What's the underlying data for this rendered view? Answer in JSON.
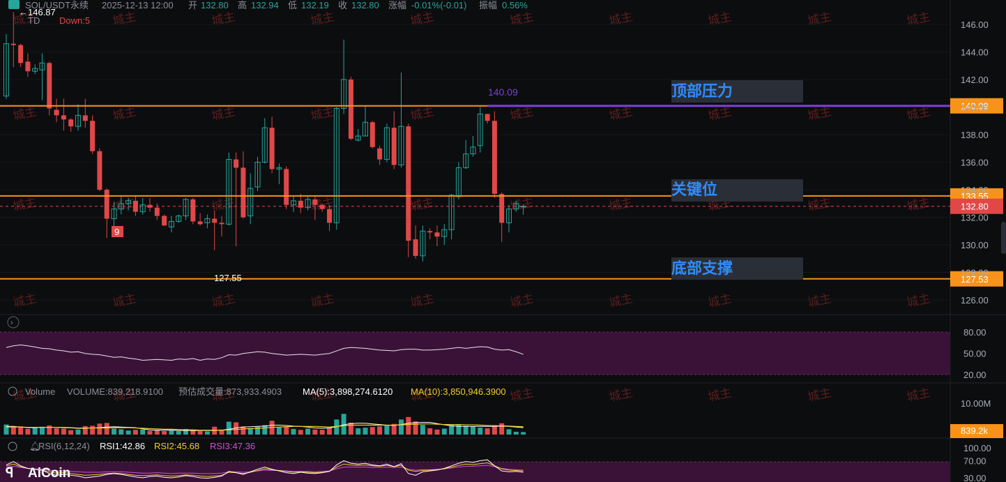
{
  "header": {
    "symbol": "SOL/USDT永续",
    "datetime": "2025-12-13 12:00",
    "open_label": "开",
    "open": "132.80",
    "high_label": "高",
    "high": "132.94",
    "low_label": "低",
    "low": "132.19",
    "close_label": "收",
    "close": "132.80",
    "change_label": "涨幅",
    "change": "-0.01%(-0.01)",
    "amp_label": "振幅",
    "amp": "0.56%",
    "td_label": "TD",
    "td_down": "Down:5",
    "max_label": "146.87"
  },
  "watermark": "城主",
  "price_axis": {
    "ticks": [
      "146.00",
      "144.00",
      "142.00",
      "140.00",
      "138.00",
      "136.00",
      "134.00",
      "132.00",
      "130.00",
      "128.00",
      "126.00"
    ]
  },
  "levels": [
    {
      "id": "top",
      "label": "顶部压力",
      "price": 140.09,
      "tag": "140.09",
      "color": "#f7931a"
    },
    {
      "id": "key",
      "label": "关键位",
      "price": 133.55,
      "tag": "133.55",
      "color": "#f7931a"
    },
    {
      "id": "bottom",
      "label": "底部支撑",
      "price": 127.53,
      "tag": "127.53",
      "color": "#f7931a"
    }
  ],
  "current_price": {
    "value": 132.8,
    "tag": "132.80"
  },
  "purple_line": {
    "price": 140.09,
    "label": "140.09",
    "color": "#7b3fd6"
  },
  "low_marker": "127.55",
  "td_count_label": "9",
  "panel_indicator": {
    "ticks": [
      "80.00",
      "50.00",
      "20.00"
    ],
    "upper": 80,
    "lower": 20
  },
  "volume": {
    "label": "Volume",
    "volume_text": "VOLUME:839,218.9100",
    "est_text": "预估成交量:873,933.4903",
    "ma5_text": "MA(5):3,898,274.6120",
    "ma10_text": "MA(10):3,850,946.3900",
    "axis_label": "10.00M",
    "tag": "839.2k"
  },
  "rsi": {
    "label": "RSI(6,12,24)",
    "rsi1": "RSI1:42.86",
    "rsi2": "RSI2:45.68",
    "rsi3": "RSI3:47.36",
    "ticks": [
      "100.00",
      "70.00",
      "30.00"
    ]
  },
  "logo": "AiCoin",
  "colors": {
    "up": "#26a69a",
    "down": "#e04848",
    "level": "#f7931a",
    "purple": "#7b3fd6",
    "label": "#2f8cff"
  },
  "chart_data": {
    "type": "candlestick",
    "ylim": [
      125.5,
      147.5
    ],
    "candles": [
      [
        140.8,
        144.6,
        140.6,
        145.3
      ],
      [
        144.6,
        144.5,
        142.9,
        146.9
      ],
      [
        144.5,
        143.2,
        142.9,
        144.6
      ],
      [
        143.3,
        142.6,
        142.2,
        143.9
      ],
      [
        142.6,
        142.8,
        142.4,
        143.1
      ],
      [
        142.7,
        143.2,
        140.5,
        143.9
      ],
      [
        143.2,
        139.9,
        139.4,
        143.3
      ],
      [
        139.8,
        139.4,
        138.9,
        140.6
      ],
      [
        139.4,
        139.1,
        138.3,
        140.6
      ],
      [
        139.1,
        138.6,
        138.2,
        139.2
      ],
      [
        138.6,
        139.4,
        138.3,
        140.2
      ],
      [
        139.4,
        139.0,
        138.5,
        140.6
      ],
      [
        139.0,
        136.8,
        136.6,
        139.4
      ],
      [
        136.8,
        134.0,
        133.9,
        137.0
      ],
      [
        134.0,
        131.9,
        130.5,
        134.1
      ],
      [
        131.9,
        132.6,
        131.2,
        133.1
      ],
      [
        132.6,
        133.0,
        132.2,
        133.6
      ],
      [
        133.0,
        133.2,
        132.5,
        133.4
      ],
      [
        133.2,
        132.4,
        132.1,
        133.6
      ],
      [
        132.4,
        132.9,
        132.2,
        133.4
      ],
      [
        132.9,
        132.7,
        132.4,
        133.4
      ],
      [
        132.7,
        132.1,
        131.8,
        133.0
      ],
      [
        132.1,
        131.4,
        131.4,
        132.2
      ],
      [
        131.3,
        131.7,
        130.9,
        132.1
      ],
      [
        131.7,
        132.1,
        131.6,
        132.2
      ],
      [
        132.1,
        133.3,
        131.8,
        133.4
      ],
      [
        133.3,
        131.7,
        131.5,
        133.4
      ],
      [
        131.7,
        131.5,
        131.4,
        132.3
      ],
      [
        131.6,
        131.9,
        131.2,
        132.2
      ],
      [
        131.9,
        131.6,
        129.6,
        132.5
      ],
      [
        131.6,
        131.5,
        130.6,
        132.1
      ],
      [
        131.5,
        136.2,
        131.4,
        136.7
      ],
      [
        136.2,
        135.6,
        129.9,
        136.7
      ],
      [
        135.6,
        132.0,
        131.9,
        136.8
      ],
      [
        132.1,
        134.1,
        131.5,
        135.2
      ],
      [
        134.2,
        136.0,
        133.9,
        136.4
      ],
      [
        136.0,
        138.5,
        135.9,
        139.2
      ],
      [
        138.5,
        135.5,
        135.2,
        139.3
      ],
      [
        135.5,
        135.6,
        134.4,
        135.9
      ],
      [
        135.5,
        132.9,
        132.6,
        135.7
      ],
      [
        132.9,
        133.2,
        132.4,
        133.6
      ],
      [
        133.2,
        132.7,
        132.3,
        133.7
      ],
      [
        132.7,
        133.3,
        132.5,
        133.6
      ],
      [
        133.3,
        132.9,
        131.8,
        133.6
      ],
      [
        132.9,
        132.6,
        132.4,
        133.0
      ],
      [
        132.6,
        131.6,
        131.0,
        132.9
      ],
      [
        131.6,
        139.9,
        131.1,
        140.0
      ],
      [
        139.9,
        142.0,
        139.5,
        144.9
      ],
      [
        142.0,
        137.7,
        137.6,
        142.2
      ],
      [
        137.6,
        137.9,
        137.5,
        138.4
      ],
      [
        137.9,
        138.9,
        137.9,
        140.1
      ],
      [
        138.9,
        137.1,
        137.0,
        139.0
      ],
      [
        137.0,
        136.2,
        135.8,
        137.2
      ],
      [
        136.2,
        138.5,
        136.0,
        138.8
      ],
      [
        138.5,
        135.8,
        135.5,
        139.7
      ],
      [
        135.8,
        138.6,
        135.6,
        142.5
      ],
      [
        138.6,
        130.3,
        129.1,
        138.8
      ],
      [
        130.4,
        129.2,
        129.0,
        131.4
      ],
      [
        129.2,
        131.0,
        128.8,
        131.4
      ],
      [
        131.0,
        130.9,
        130.4,
        131.2
      ],
      [
        130.9,
        130.6,
        129.9,
        131.4
      ],
      [
        130.6,
        131.1,
        130.0,
        131.5
      ],
      [
        131.1,
        133.6,
        130.4,
        133.7
      ],
      [
        133.5,
        135.6,
        133.3,
        136.0
      ],
      [
        135.6,
        136.6,
        135.5,
        137.6
      ],
      [
        136.6,
        137.1,
        136.4,
        137.9
      ],
      [
        137.2,
        139.5,
        136.7,
        140.0
      ],
      [
        139.5,
        139.0,
        138.8,
        139.5
      ],
      [
        139.0,
        133.7,
        133.4,
        139.7
      ],
      [
        133.7,
        131.6,
        130.2,
        133.8
      ],
      [
        131.6,
        132.6,
        130.9,
        132.9
      ],
      [
        132.6,
        133.0,
        132.4,
        133.2
      ],
      [
        132.8,
        132.8,
        132.19,
        132.94
      ]
    ],
    "rsi_series": [
      72,
      76,
      78,
      76,
      73,
      70,
      69,
      66,
      64,
      61,
      62,
      58,
      56,
      55,
      52,
      49,
      50,
      47,
      45,
      42,
      43,
      44,
      43,
      42,
      45,
      44,
      46,
      42,
      45,
      44,
      48,
      55,
      54,
      58,
      60,
      62,
      61,
      58,
      56,
      54,
      55,
      56,
      55,
      54,
      56,
      58,
      64,
      70,
      72,
      71,
      70,
      68,
      66,
      65,
      64,
      67,
      68,
      68,
      66,
      66,
      67,
      68,
      70,
      72,
      70,
      72,
      74,
      73,
      68,
      66,
      67,
      62,
      56
    ],
    "volume_series": [
      3.2,
      2.4,
      2.6,
      1.8,
      2.1,
      2.5,
      2.9,
      2.0,
      1.9,
      1.4,
      1.6,
      2.7,
      2.8,
      3.5,
      3.7,
      1.9,
      1.7,
      1.3,
      1.5,
      1.6,
      1.2,
      1.5,
      1.1,
      1.3,
      1.1,
      1.8,
      1.5,
      1.1,
      1.0,
      2.5,
      1.6,
      4.1,
      3.9,
      2.6,
      2.1,
      2.5,
      3.0,
      4.4,
      2.4,
      2.6,
      1.8,
      1.5,
      1.9,
      1.6,
      1.5,
      2.1,
      4.8,
      6.6,
      3.8,
      2.0,
      2.2,
      2.4,
      2.6,
      3.1,
      3.4,
      4.8,
      5.6,
      4.2,
      3.1,
      2.0,
      1.6,
      1.9,
      3.0,
      3.1,
      2.8,
      2.6,
      2.2,
      2.0,
      3.0,
      3.6,
      1.7,
      0.9,
      0.8
    ],
    "volume_ma5": [
      2.6,
      2.6,
      2.4,
      2.2,
      2.2,
      2.3,
      2.3,
      2.3,
      2.2,
      2.1,
      2.0,
      2.0,
      2.1,
      2.2,
      2.4,
      2.5,
      2.4,
      2.3,
      2.2,
      1.8,
      1.5,
      1.4,
      1.4,
      1.4,
      1.3,
      1.3,
      1.3,
      1.3,
      1.3,
      1.3,
      1.4,
      1.7,
      2.1,
      2.4,
      2.5,
      2.6,
      2.7,
      3.0,
      3.0,
      2.9,
      2.7,
      2.6,
      2.4,
      2.1,
      2.0,
      2.1,
      2.5,
      3.1,
      3.5,
      3.6,
      3.6,
      3.4,
      3.2,
      3.0,
      2.9,
      3.2,
      3.6,
      3.8,
      3.9,
      3.9,
      3.5,
      3.1,
      2.8,
      2.6,
      2.6,
      2.6,
      2.6,
      2.6,
      2.6,
      2.7,
      2.6,
      2.4,
      2.2
    ],
    "volume_ma10": [
      2.4,
      2.4,
      2.4,
      2.3,
      2.3,
      2.3,
      2.3,
      2.3,
      2.3,
      2.2,
      2.1,
      2.1,
      2.1,
      2.1,
      2.1,
      2.2,
      2.2,
      2.2,
      2.1,
      2.0,
      1.9,
      1.8,
      1.7,
      1.7,
      1.6,
      1.5,
      1.5,
      1.4,
      1.4,
      1.4,
      1.4,
      1.5,
      1.6,
      1.8,
      1.9,
      2.0,
      2.1,
      2.3,
      2.4,
      2.5,
      2.6,
      2.6,
      2.6,
      2.6,
      2.5,
      2.4,
      2.6,
      2.8,
      3.0,
      3.0,
      3.0,
      3.0,
      3.0,
      3.0,
      3.0,
      3.1,
      3.2,
      3.3,
      3.4,
      3.4,
      3.3,
      3.2,
      3.2,
      3.2,
      3.1,
      3.1,
      3.0,
      2.9,
      2.8,
      2.8,
      2.7,
      2.6,
      2.5
    ],
    "rsi1_series": [
      60,
      68,
      58,
      52,
      50,
      48,
      40,
      36,
      38,
      36,
      34,
      30,
      32,
      34,
      38,
      40,
      38,
      35,
      32,
      30,
      33,
      34,
      31,
      30,
      32,
      35,
      33,
      30,
      29,
      31,
      34,
      45,
      42,
      38,
      44,
      50,
      55,
      50,
      46,
      42,
      40,
      43,
      41,
      40,
      42,
      45,
      60,
      70,
      64,
      62,
      64,
      60,
      58,
      62,
      56,
      63,
      40,
      36,
      44,
      46,
      48,
      52,
      58,
      64,
      68,
      66,
      70,
      72,
      58,
      46,
      44,
      45,
      43
    ],
    "rsi2_series": [
      58,
      62,
      56,
      52,
      50,
      48,
      44,
      41,
      42,
      40,
      38,
      36,
      37,
      38,
      40,
      41,
      40,
      38,
      36,
      35,
      36,
      37,
      35,
      34,
      35,
      37,
      36,
      34,
      33,
      34,
      36,
      43,
      42,
      40,
      43,
      47,
      51,
      49,
      47,
      45,
      43,
      44,
      43,
      42,
      43,
      45,
      55,
      62,
      60,
      59,
      60,
      58,
      57,
      59,
      56,
      59,
      48,
      45,
      47,
      48,
      49,
      51,
      55,
      59,
      62,
      61,
      63,
      65,
      58,
      51,
      48,
      47,
      46
    ],
    "rsi3_series": [
      55,
      57,
      54,
      52,
      51,
      50,
      48,
      46,
      46,
      45,
      44,
      43,
      43,
      43,
      44,
      44,
      44,
      43,
      42,
      41,
      41,
      42,
      41,
      40,
      41,
      41,
      41,
      40,
      40,
      40,
      41,
      44,
      44,
      43,
      44,
      46,
      48,
      47,
      47,
      46,
      45,
      45,
      45,
      44,
      45,
      46,
      51,
      55,
      55,
      55,
      55,
      54,
      54,
      55,
      54,
      55,
      50,
      48,
      49,
      49,
      50,
      51,
      53,
      55,
      57,
      57,
      58,
      59,
      56,
      52,
      50,
      49,
      48
    ]
  }
}
